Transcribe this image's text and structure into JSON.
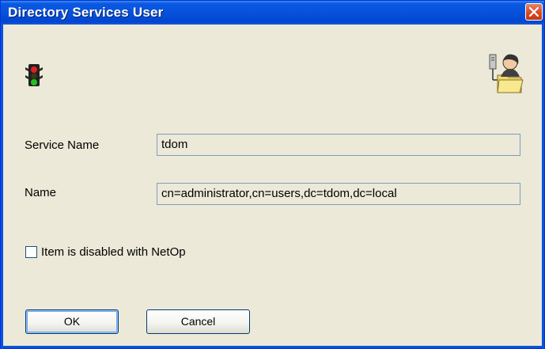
{
  "window": {
    "title": "Directory Services User",
    "close_icon": "close-icon"
  },
  "icons": {
    "status": "traffic-light-icon",
    "user": "directory-user-icon"
  },
  "form": {
    "service_name_label": "Service Name",
    "service_name_value": "tdom",
    "name_label": "Name",
    "name_value": "cn=administrator,cn=users,dc=tdom,dc=local",
    "disabled_checkbox_label": "Item is disabled with NetOp",
    "disabled_checked": false
  },
  "buttons": {
    "ok_label": "OK",
    "cancel_label": "Cancel"
  },
  "colors": {
    "titlebar": "#0752dc",
    "face": "#ece9d8",
    "close": "#d84a27"
  }
}
